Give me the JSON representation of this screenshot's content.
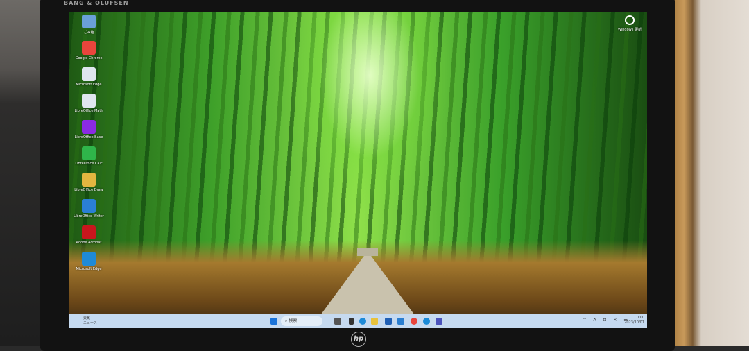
{
  "bezel": {
    "brand": "BANG & OLUFSEN",
    "logo": "hp"
  },
  "desktop_icons": [
    {
      "label": "ごみ箱",
      "color": "#6aa0d8"
    },
    {
      "label": "Google Chrome",
      "color": "#e8453c"
    },
    {
      "label": "Microsoft Edge",
      "color": "#dfe6ee"
    },
    {
      "label": "LibreOffice Math",
      "color": "#dfe6ee"
    },
    {
      "label": "LibreOffice Base",
      "color": "#8a2be2"
    },
    {
      "label": "LibreOffice Calc",
      "color": "#2fb54a"
    },
    {
      "label": "LibreOffice Draw",
      "color": "#e2b640"
    },
    {
      "label": "LibreOffice Writer",
      "color": "#2a7fd4"
    },
    {
      "label": "Adobe Acrobat",
      "color": "#c8161d"
    },
    {
      "label": "Microsoft Edge",
      "color": "#1f8ad6"
    }
  ],
  "widget": {
    "label": "Windows 更新"
  },
  "taskbar": {
    "weather": [
      "天気",
      "ニュース"
    ],
    "search_placeholder": "検索",
    "tray": "^ A ⊡ ✕ ▬",
    "time": "0:00",
    "date": "2023/10/01"
  }
}
